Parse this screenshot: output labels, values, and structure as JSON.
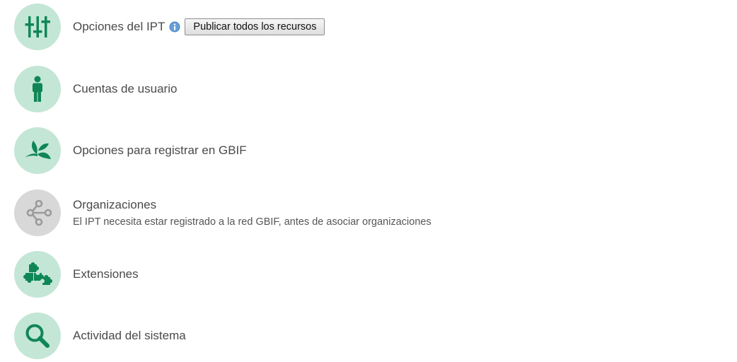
{
  "menu": {
    "items": [
      {
        "label": "Opciones del IPT",
        "icon": "sliders-icon",
        "info_icon": "info-icon",
        "button_label": "Publicar todos los recursos"
      },
      {
        "label": "Cuentas de usuario",
        "icon": "user-icon"
      },
      {
        "label": "Opciones para registrar en GBIF",
        "icon": "leaf-icon"
      },
      {
        "label": "Organizaciones",
        "sublabel": "El IPT necesita estar registrado a la red GBIF, antes de asociar organizaciones",
        "icon": "network-icon",
        "disabled": true
      },
      {
        "label": "Extensiones",
        "icon": "puzzle-icon"
      },
      {
        "label": "Actividad del sistema",
        "icon": "magnifier-icon"
      }
    ]
  },
  "colors": {
    "icon_background": "#c4e6d6",
    "icon_background_disabled": "#d8d8d8",
    "icon_foreground": "#0f8656",
    "icon_foreground_disabled": "#9b9b9b",
    "info_icon": "#4a86c5",
    "text": "#4a4a4a"
  }
}
